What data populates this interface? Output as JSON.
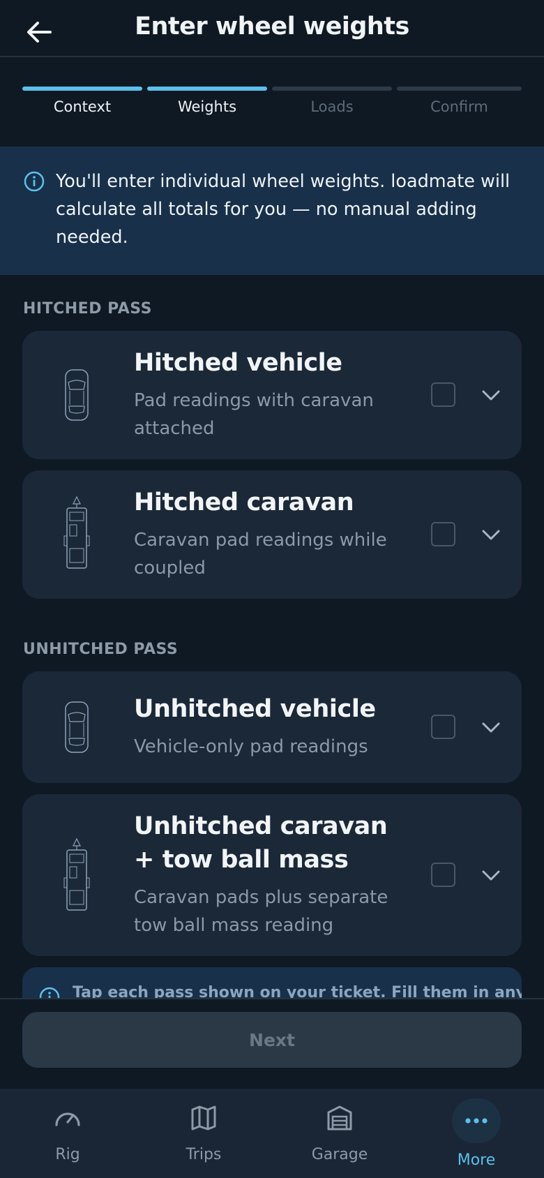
{
  "header": {
    "title": "Enter wheel weights"
  },
  "stepper": {
    "steps": [
      {
        "label": "Context"
      },
      {
        "label": "Weights"
      },
      {
        "label": "Loads"
      },
      {
        "label": "Confirm"
      }
    ],
    "completed_count": 2
  },
  "info": {
    "text": "You'll enter individual wheel weights. loadmate will calculate all totals for you — no manual adding needed."
  },
  "sections": [
    {
      "label": "HITCHED PASS",
      "cards": [
        {
          "title": "Hitched vehicle",
          "subtitle": "Pad readings with caravan attached",
          "icon": "car-topview-icon",
          "checked": false
        },
        {
          "title": "Hitched caravan",
          "subtitle": "Caravan pad readings while coupled",
          "icon": "caravan-topview-icon",
          "checked": false
        }
      ]
    },
    {
      "label": "UNHITCHED PASS",
      "cards": [
        {
          "title": "Unhitched vehicle",
          "subtitle": "Vehicle-only pad readings",
          "icon": "car-topview-icon",
          "checked": false
        },
        {
          "title": "Unhitched caravan + tow ball mass",
          "subtitle": "Caravan pads plus separate tow ball mass reading",
          "icon": "caravan-topview-icon",
          "checked": false
        }
      ]
    }
  ],
  "tip": {
    "text": "Tap each pass shown on your ticket. Fill them in any"
  },
  "footer": {
    "next_label": "Next"
  },
  "tabbar": {
    "tabs": [
      {
        "label": "Rig",
        "icon": "gauge-icon"
      },
      {
        "label": "Trips",
        "icon": "map-icon"
      },
      {
        "label": "Garage",
        "icon": "garage-icon"
      },
      {
        "label": "More",
        "icon": "more-dots-icon",
        "active": true
      }
    ]
  },
  "colors": {
    "accent": "#5cc0ec",
    "background": "#0f1923",
    "card": "#1b2838",
    "banner": "#18304a"
  }
}
